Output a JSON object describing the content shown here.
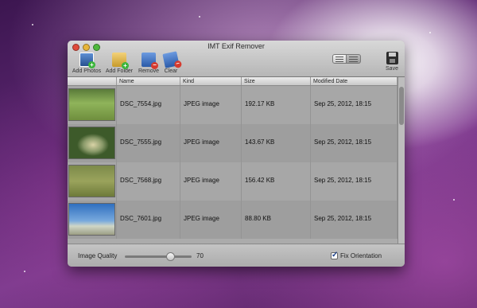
{
  "window": {
    "title": "IMT Exif Remover"
  },
  "toolbar": {
    "add_photos": "Add Photos",
    "add_folder": "Add Folder",
    "remove": "Remove",
    "clear": "Clear",
    "save": "Save"
  },
  "table": {
    "columns": [
      "",
      "Name",
      "Kind",
      "Size",
      "Modified Date"
    ],
    "rows": [
      {
        "name": "DSC_7554.jpg",
        "kind": "JPEG image",
        "size": "192.17 KB",
        "modified": "Sep 25, 2012, 18:15"
      },
      {
        "name": "DSC_7555.jpg",
        "kind": "JPEG image",
        "size": "143.67 KB",
        "modified": "Sep 25, 2012, 18:15"
      },
      {
        "name": "DSC_7568.jpg",
        "kind": "JPEG image",
        "size": "156.42 KB",
        "modified": "Sep 25, 2012, 18:15"
      },
      {
        "name": "DSC_7601.jpg",
        "kind": "JPEG image",
        "size": "88.80 KB",
        "modified": "Sep 25, 2012, 18:15"
      }
    ]
  },
  "footer": {
    "image_quality_label": "Image Quality",
    "image_quality_value": "70",
    "fix_orientation_label": "Fix Orientation",
    "fix_orientation_checked": true
  }
}
